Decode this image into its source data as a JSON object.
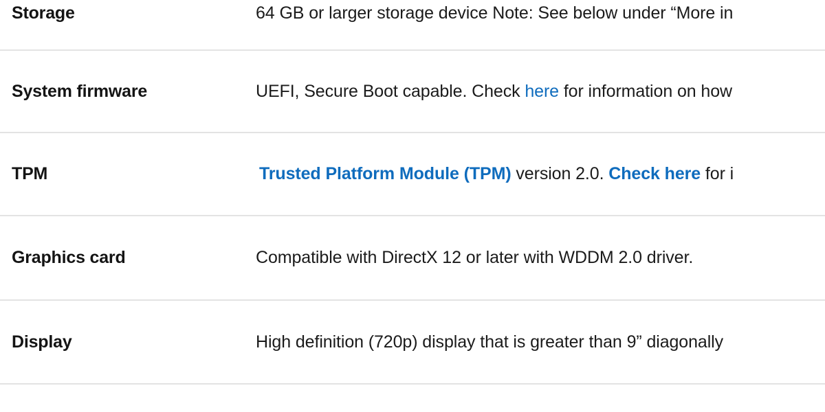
{
  "table": {
    "link_color": "#0f6cbd",
    "text_color": "#1b1b1b",
    "divider_color": "#e3e3e3",
    "rows": [
      {
        "label": "Storage",
        "value_parts": [
          {
            "text": "64 GB or larger storage device Note: See below under “More in",
            "link": false
          }
        ]
      },
      {
        "label": "System firmware",
        "value_parts": [
          {
            "text": "UEFI, Secure Boot capable. Check ",
            "link": false
          },
          {
            "text": "here",
            "link": true,
            "bold": false
          },
          {
            "text": " for information on how",
            "link": false
          }
        ]
      },
      {
        "label": "TPM",
        "value_parts": [
          {
            "text": "Trusted Platform Module (TPM)",
            "link": true,
            "bold": true
          },
          {
            "text": " version 2.0. ",
            "link": false
          },
          {
            "text": "Check here",
            "link": true,
            "bold": true
          },
          {
            "text": " for i",
            "link": false
          }
        ]
      },
      {
        "label": "Graphics card",
        "value_parts": [
          {
            "text": "Compatible with DirectX 12 or later with WDDM 2.0 driver.",
            "link": false
          }
        ]
      },
      {
        "label": "Display",
        "value_parts": [
          {
            "text": "High definition (720p) display that is greater than 9” diagonally",
            "link": false
          }
        ]
      }
    ]
  }
}
